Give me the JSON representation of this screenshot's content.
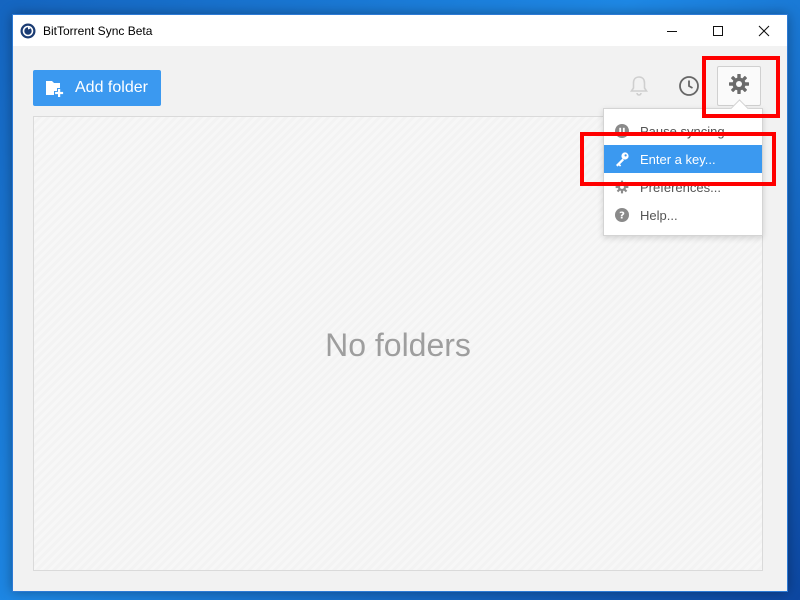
{
  "window": {
    "title": "BitTorrent Sync Beta",
    "controls": [
      "minimize",
      "maximize",
      "close"
    ]
  },
  "toolbar": {
    "add_folder_label": "Add folder"
  },
  "main": {
    "empty_text": "No folders"
  },
  "settings_menu": {
    "items": [
      {
        "label": "Pause syncing",
        "icon": "pause-icon"
      },
      {
        "label": "Enter a key...",
        "icon": "key-icon",
        "active": true
      },
      {
        "label": "Preferences...",
        "icon": "gear-icon"
      },
      {
        "label": "Help...",
        "icon": "help-icon"
      }
    ]
  },
  "colors": {
    "accent": "#3b99f0",
    "highlight": "#ff0000",
    "window_border": "#2d7ad4"
  }
}
